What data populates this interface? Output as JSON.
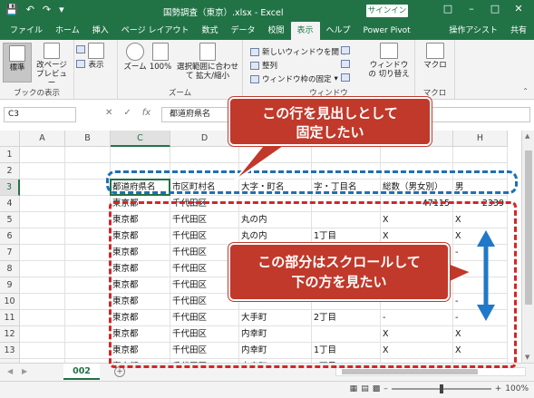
{
  "window": {
    "title": "国勢調査（東京）.xlsx - Excel",
    "signin": "サインイン"
  },
  "tabs": [
    "ファイル",
    "ホーム",
    "挿入",
    "ページ レイアウト",
    "数式",
    "データ",
    "校閲",
    "表示",
    "ヘルプ",
    "Power Pivot"
  ],
  "active_tab": "表示",
  "tabs_right": [
    "操作アシスト",
    "共有"
  ],
  "ribbon": {
    "book_view": {
      "normal": "標準",
      "page_break": "改ページ プレビュー",
      "label": "ブックの表示"
    },
    "show": {
      "label": "表示"
    },
    "zoom": {
      "zoom": "ズーム",
      "hundred": "100%",
      "fit": "選択範囲に合わせて 拡大/縮小",
      "label": "ズーム"
    },
    "window": {
      "new_window": "新しいウィンドウを開く",
      "arrange": "整列",
      "freeze": "ウィンドウ枠の固定",
      "switch": "ウィンドウの 切り替え",
      "label": "ウィンドウ"
    },
    "macro": {
      "macro": "マクロ",
      "label": "マクロ"
    }
  },
  "formula_bar": {
    "name_box": "C3",
    "fx": "fx",
    "content": "都道府県名"
  },
  "columns": [
    "A",
    "B",
    "C",
    "D",
    "E",
    "F",
    "G",
    "H"
  ],
  "selected_column": "C",
  "rows": [
    {
      "n": "1",
      "cells": [
        "",
        "",
        "",
        "",
        "",
        "",
        "",
        ""
      ]
    },
    {
      "n": "2",
      "cells": [
        "",
        "",
        "",
        "",
        "",
        "",
        "",
        ""
      ]
    },
    {
      "n": "3",
      "cells": [
        "",
        "",
        "都道府県名",
        "市区町村名",
        "大字・町名",
        "字・丁目名",
        "総数（男女別）",
        "男"
      ]
    },
    {
      "n": "4",
      "cells": [
        "",
        "",
        "東京都",
        "千代田区",
        "",
        "",
        "47115",
        "2339"
      ]
    },
    {
      "n": "5",
      "cells": [
        "",
        "",
        "東京都",
        "千代田区",
        "丸の内",
        "",
        "X",
        "X"
      ]
    },
    {
      "n": "6",
      "cells": [
        "",
        "",
        "東京都",
        "千代田区",
        "丸の内",
        "1丁目",
        "X",
        "X"
      ]
    },
    {
      "n": "7",
      "cells": [
        "",
        "",
        "東京都",
        "千代田区",
        "",
        "",
        "",
        "-"
      ]
    },
    {
      "n": "8",
      "cells": [
        "",
        "",
        "東京都",
        "千代田区",
        "",
        "",
        "",
        ""
      ]
    },
    {
      "n": "9",
      "cells": [
        "",
        "",
        "東京都",
        "千代田区",
        "",
        "",
        "",
        ""
      ]
    },
    {
      "n": "10",
      "cells": [
        "",
        "",
        "東京都",
        "千代田区",
        "",
        "",
        "",
        "-"
      ]
    },
    {
      "n": "11",
      "cells": [
        "",
        "",
        "東京都",
        "千代田区",
        "大手町",
        "2丁目",
        "-",
        "-"
      ]
    },
    {
      "n": "12",
      "cells": [
        "",
        "",
        "東京都",
        "千代田区",
        "内幸町",
        "",
        "X",
        "X"
      ]
    },
    {
      "n": "13",
      "cells": [
        "",
        "",
        "東京都",
        "千代田区",
        "内幸町",
        "1丁目",
        "X",
        "X"
      ]
    },
    {
      "n": "14",
      "cells": [
        "",
        "",
        "東京都",
        "千代田区",
        "内幸町",
        "2丁目",
        "-",
        "-"
      ]
    }
  ],
  "sheet_tab": "002",
  "zoom_level": "100%",
  "annotations": {
    "header_callout_1": "この行を見出しとして",
    "header_callout_2": "固定したい",
    "scroll_callout_1": "この部分はスクロールして",
    "scroll_callout_2": "下の方を見たい"
  },
  "colors": {
    "excel_green": "#217346",
    "callout_red": "#c0392b",
    "arrow_blue": "#1f78c8"
  }
}
